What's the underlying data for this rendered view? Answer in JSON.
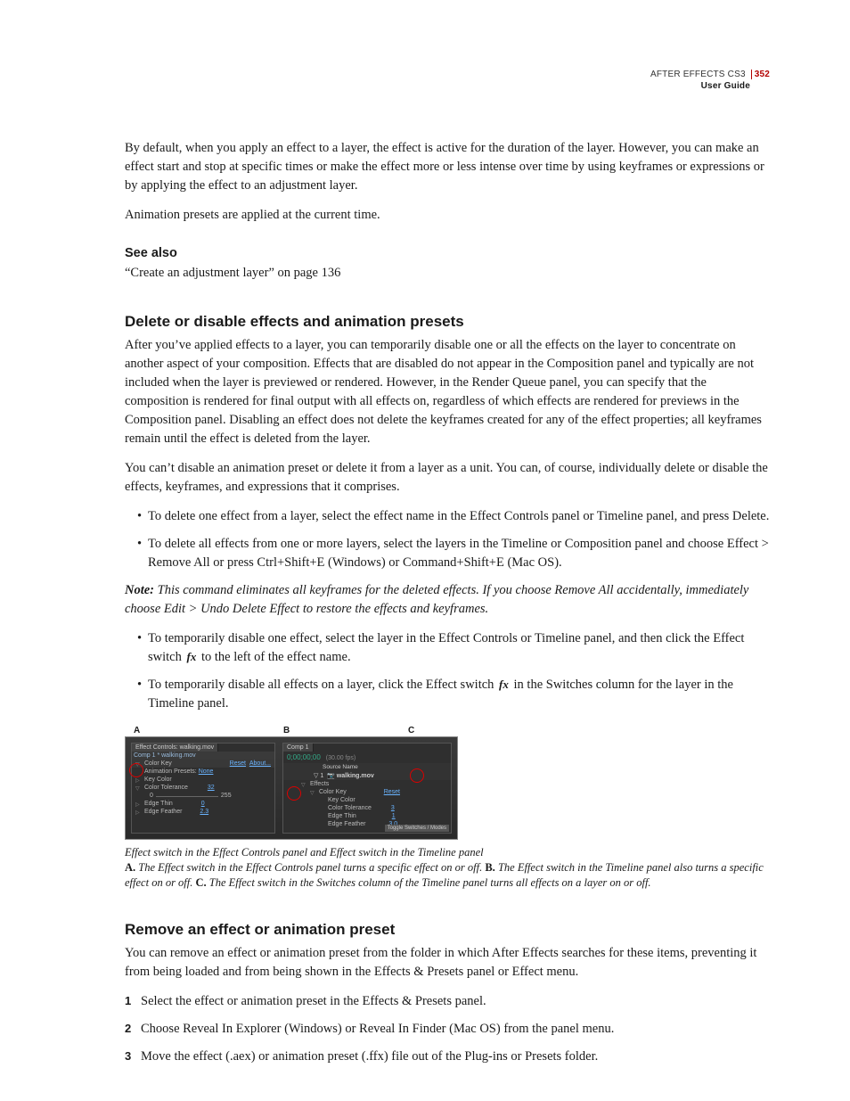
{
  "header": {
    "product": "AFTER EFFECTS CS3",
    "guide": "User Guide",
    "page_number": "352"
  },
  "intro": {
    "p1": "By default, when you apply an effect to a layer, the effect is active for the duration of the layer. However, you can make an effect start and stop at specific times or make the effect more or less intense over time by using keyframes or expressions or by applying the effect to an adjustment layer.",
    "p2": "Animation presets are applied at the current time."
  },
  "see_also": {
    "title": "See also",
    "link": "“Create an adjustment layer” on page 136"
  },
  "section1": {
    "title": "Delete or disable effects and animation presets",
    "p1": "After you’ve applied effects to a layer, you can temporarily disable one or all the effects on the layer to concentrate on another aspect of your composition. Effects that are disabled do not appear in the Composition panel and typically are not included when the layer is previewed or rendered. However, in the Render Queue panel, you can specify that the composition is rendered for final output with all effects on, regardless of which effects are rendered for previews in the Composition panel. Disabling an effect does not delete the keyframes created for any of the effect properties; all keyframes remain until the effect is deleted from the layer.",
    "p2": "You can’t disable an animation preset or delete it from a layer as a unit. You can, of course, individually delete or disable the effects, keyframes, and expressions that it comprises.",
    "bullets1": [
      "To delete one effect from a layer, select the effect name in the Effect Controls panel or Timeline panel, and press Delete.",
      "To delete all effects from one or more layers, select the layers in the Timeline or Composition panel and choose Effect > Remove All or press Ctrl+Shift+E (Windows) or Command+Shift+E (Mac OS)."
    ],
    "note_label": "Note:",
    "note_text": " This command eliminates all keyframes for the deleted effects. If you choose Remove All accidentally, immediately choose Edit > Undo Delete Effect to restore the effects and keyframes.",
    "bullet3_a": "To temporarily disable one effect, select the layer in the Effect Controls or Timeline panel, and then click the Effect switch ",
    "bullet3_b": " to the left of the effect name.",
    "bullet4_a": "To temporarily disable all effects on a layer, click the Effect switch ",
    "bullet4_b": " in the Switches column for the layer in the Timeline panel.",
    "fx_glyph": "fx"
  },
  "figure": {
    "labels": {
      "a": "A",
      "b": "B",
      "c": "C"
    },
    "panelA": {
      "tab": "Effect Controls: walking.mov",
      "header": "Comp 1 * walking.mov",
      "effect_name": "Color Key",
      "reset": "Reset",
      "about": "About...",
      "preset_label": "Animation Presets:",
      "preset_value": "None",
      "rows": [
        {
          "name": "Key Color",
          "value": ""
        },
        {
          "name": "Color Tolerance",
          "value": "32"
        },
        {
          "name": "Edge Thin",
          "value": "0"
        },
        {
          "name": "Edge Feather",
          "value": "2.3"
        }
      ],
      "slider_min": "0",
      "slider_max": "255"
    },
    "panelB": {
      "tab": "Comp 1",
      "timecode": "0;00;00;00",
      "fps": "(30.00 fps)",
      "col": "Source Name",
      "layer": "walking.mov",
      "effects_label": "Effects",
      "effect_name": "Color Key",
      "reset": "Reset",
      "rows": [
        {
          "name": "Key Color",
          "value": ""
        },
        {
          "name": "Color Tolerance",
          "value": "3"
        },
        {
          "name": "Edge Thin",
          "value": "1"
        },
        {
          "name": "Edge Feather",
          "value": "3.0"
        }
      ],
      "footer": "Toggle Switches / Modes"
    },
    "caption_lead": "Effect switch in the Effect Controls panel and Effect switch in the Timeline panel",
    "caption_a_label": "A.",
    "caption_a": " The Effect switch in the Effect Controls panel turns a specific effect on or off. ",
    "caption_b_label": "B.",
    "caption_b": " The Effect switch in the Timeline panel also turns a specific effect on or off. ",
    "caption_c_label": "C.",
    "caption_c": " The Effect switch in the Switches column of the Timeline panel turns all effects on a layer on or off."
  },
  "section2": {
    "title": "Remove an effect or animation preset",
    "p1": "You can remove an effect or animation preset from the folder in which After Effects searches for these items, preventing it from being loaded and from being shown in the Effects & Presets panel or Effect menu.",
    "steps": [
      "Select the effect or animation preset in the Effects & Presets panel.",
      "Choose Reveal In Explorer (Windows) or Reveal In Finder (Mac OS) from the panel menu.",
      "Move the effect (.aex) or animation preset (.ffx) file out of the Plug-ins or Presets folder."
    ]
  }
}
